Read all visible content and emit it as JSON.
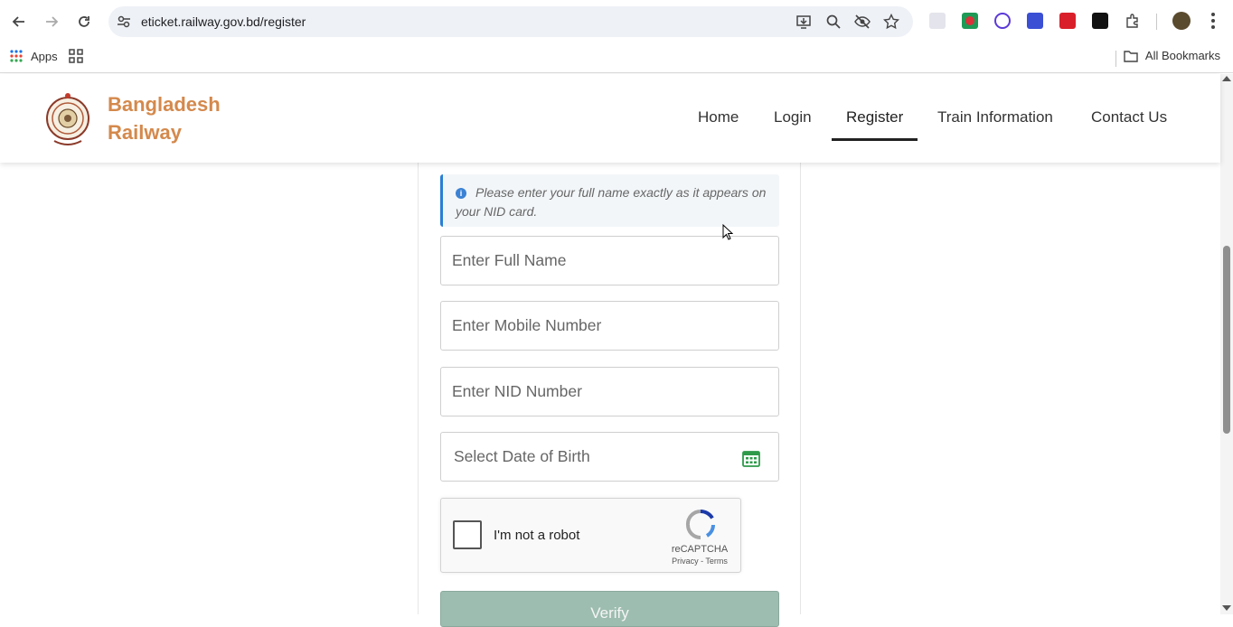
{
  "browser": {
    "url": "eticket.railway.gov.bd/register",
    "bookmarks": {
      "apps_label": "Apps",
      "all_bookmarks_label": "All Bookmarks"
    }
  },
  "site": {
    "brand_line1": "Bangladesh",
    "brand_line2": "Railway",
    "nav": [
      {
        "label": "Home"
      },
      {
        "label": "Login"
      },
      {
        "label": "Register",
        "active": true
      },
      {
        "label": "Train Information"
      },
      {
        "label": "Contact Us"
      }
    ],
    "brand_color": "#d4894c"
  },
  "form": {
    "notice": "Please enter your full name exactly as it appears on your NID card.",
    "full_name_placeholder": "Enter Full Name",
    "mobile_placeholder": "Enter Mobile Number",
    "nid_placeholder": "Enter NID Number",
    "dob_placeholder": "Select Date of Birth",
    "recaptcha_label": "I'm not a robot",
    "recaptcha_brand": "reCAPTCHA",
    "recaptcha_links": "Privacy - Terms",
    "verify_label": "Verify"
  }
}
